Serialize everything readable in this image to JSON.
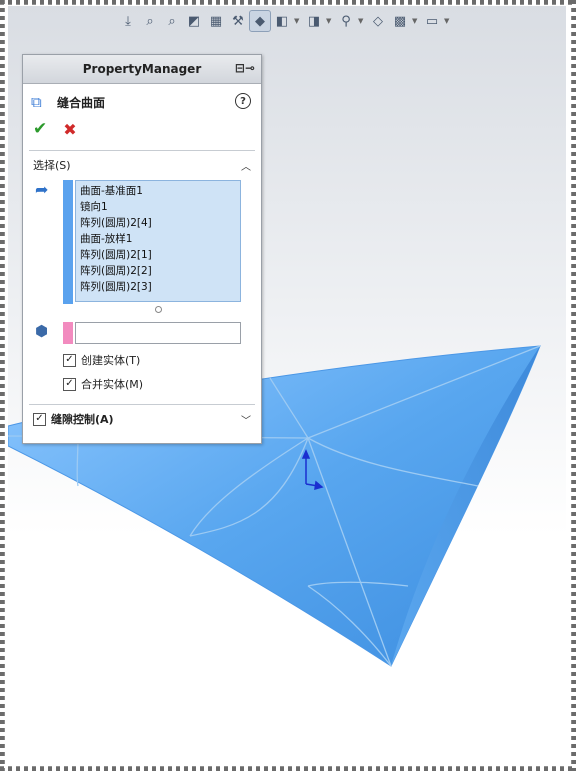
{
  "panel": {
    "title": "PropertyManager",
    "feature_name": "缝合曲面",
    "help_glyph": "?",
    "ok_glyph": "✔",
    "cancel_glyph": "✖"
  },
  "selections_group": {
    "title": "选择(S)",
    "items": [
      "曲面-基准面1",
      "镜向1",
      "阵列(圆周)2[4]",
      "曲面-放样1",
      "阵列(圆周)2[1]",
      "阵列(圆周)2[2]",
      "阵列(圆周)2[3]"
    ]
  },
  "options": {
    "create_solid": {
      "label": "创建实体(T)",
      "checked": true
    },
    "merge_entities": {
      "label": "合并实体(M)",
      "checked": true
    }
  },
  "gap_control": {
    "label": "缝隙控制(A)",
    "checked": true
  },
  "colors": {
    "surface": "#5aa8ee",
    "selection_bg": "#cfe3f6",
    "selection_bar": "#5aa2ee",
    "body_bar": "#f28bbf",
    "ok": "#2c9a2c",
    "cancel": "#d02a2a"
  },
  "icons": [
    "zoom-to-fit-icon",
    "zoom-area-icon",
    "previous-view-icon",
    "section-view-icon",
    "view-orientation-icon",
    "display-style-icon",
    "hide-show-icon",
    "edit-appearance-icon",
    "scene-icon",
    "view-settings-icon",
    "monitor-icon",
    "pin-icon",
    "stitch-surface-icon",
    "selection-faces-icon",
    "solid-body-icon",
    "triad-icon"
  ]
}
